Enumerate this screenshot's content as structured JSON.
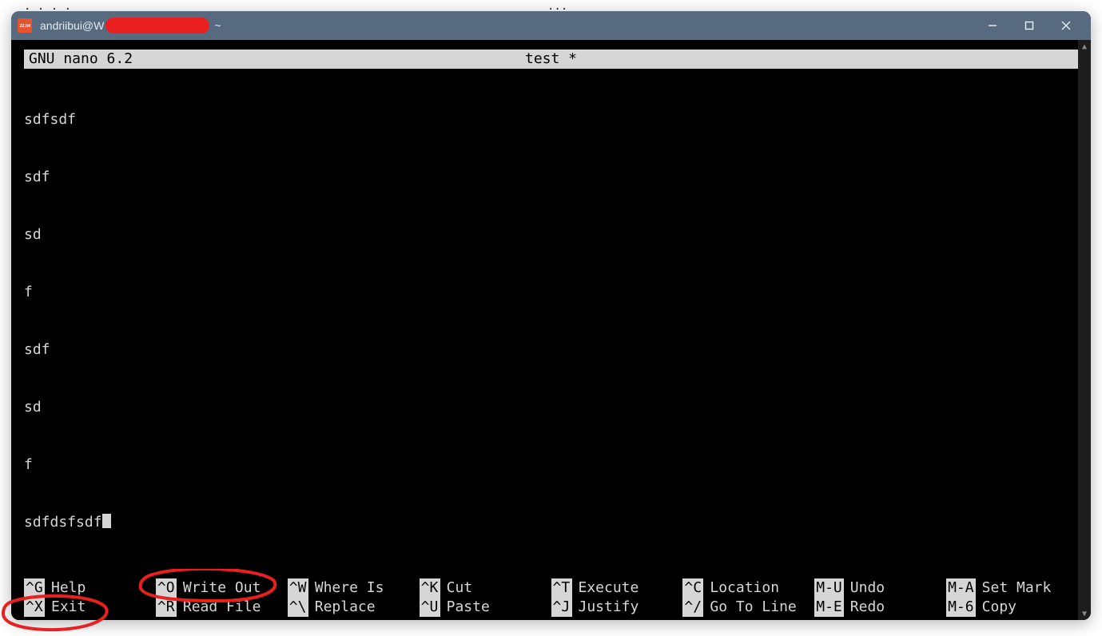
{
  "window": {
    "app_icon_text": "22.04",
    "title_prefix": "andriibui@W",
    "title_suffix": "~"
  },
  "nano": {
    "version_label": "GNU nano 6.2",
    "filename_status": "test *",
    "lines": [
      "sdfsdf",
      "sdf",
      "sd",
      "f",
      "sdf",
      "sd",
      "f",
      "sdfdsfsdf"
    ],
    "shortcuts_row1": [
      {
        "key": "^G",
        "label": "Help"
      },
      {
        "key": "^O",
        "label": "Write Out"
      },
      {
        "key": "^W",
        "label": "Where Is"
      },
      {
        "key": "^K",
        "label": "Cut"
      },
      {
        "key": "^T",
        "label": "Execute"
      },
      {
        "key": "^C",
        "label": "Location"
      },
      {
        "key": "M-U",
        "label": "Undo"
      },
      {
        "key": "M-A",
        "label": "Set Mark"
      }
    ],
    "shortcuts_row2": [
      {
        "key": "^X",
        "label": "Exit"
      },
      {
        "key": "^R",
        "label": "Read File"
      },
      {
        "key": "^\\",
        "label": "Replace"
      },
      {
        "key": "^U",
        "label": "Paste"
      },
      {
        "key": "^J",
        "label": "Justify"
      },
      {
        "key": "^/",
        "label": "Go To Line"
      },
      {
        "key": "M-E",
        "label": "Redo"
      },
      {
        "key": "M-6",
        "label": "Copy"
      }
    ]
  },
  "remnants": {
    "left": "   . .        .    .",
    "right": "   ..."
  }
}
